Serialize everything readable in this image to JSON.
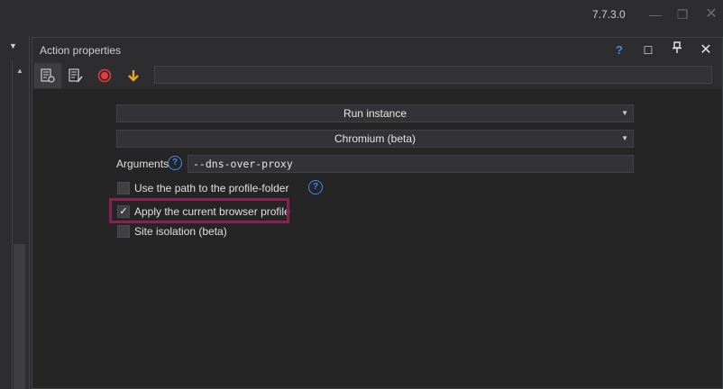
{
  "app": {
    "version": "7.7.3.0",
    "window_controls": {
      "minimize": "—",
      "restore": "❐",
      "close": "✕"
    }
  },
  "panel": {
    "title": "Action properties",
    "header_buttons": {
      "help": "?",
      "maximize": "☐",
      "pin": "📌",
      "close": "✕"
    }
  },
  "toolbar": {
    "icons": [
      "settings-list-icon",
      "edit-list-icon",
      "record-icon",
      "arrow-down-icon"
    ],
    "field_value": ""
  },
  "form": {
    "action_select": "Run instance",
    "browser_select": "Chromium (beta)",
    "arguments_label": "Arguments",
    "arguments_value": "--dns-over-proxy",
    "options": [
      {
        "label": "Use the path to the profile-folder",
        "checked": false
      },
      {
        "label": "Apply the current browser profile",
        "checked": true
      },
      {
        "label": "Site isolation (beta)",
        "checked": false
      }
    ]
  },
  "colors": {
    "accent_blue": "#3c8cf0",
    "record_red": "#e83a3a",
    "arrow_orange": "#f0a020",
    "highlight": "#8a2056",
    "panel_bg": "#252526"
  }
}
